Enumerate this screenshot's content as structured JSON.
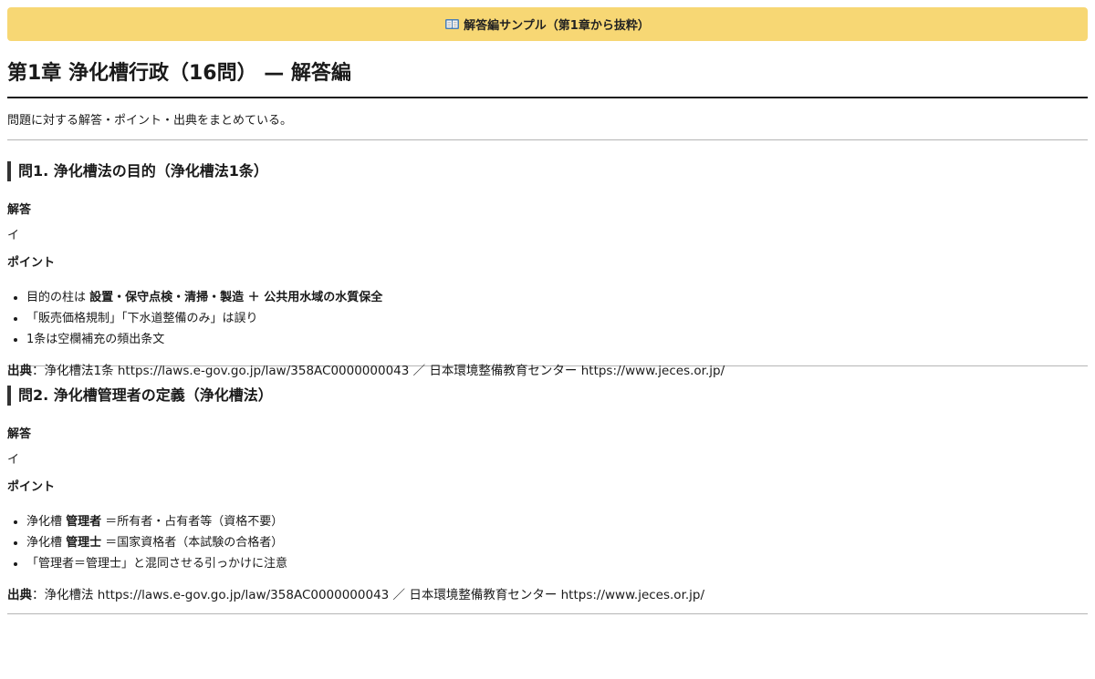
{
  "banner": {
    "icon": "book-icon",
    "text": "解答編サンプル（第1章から抜粋）"
  },
  "page_title": "第1章 浄化槽行政（16問） — 解答編",
  "intro": "問題に対する解答・ポイント・出典をまとめている。",
  "questions": [
    {
      "title": "問1. 浄化槽法の目的（浄化槽法1条）",
      "answer_label": "解答",
      "answer": "イ",
      "points_label": "ポイント",
      "points": [
        {
          "pre": "目的の柱は ",
          "bold": "設置・保守点検・清掃・製造 ＋ 公共用水域の水質保全",
          "post": ""
        },
        {
          "pre": "「販売価格規制」「下水道整備のみ」は誤り",
          "bold": "",
          "post": ""
        },
        {
          "pre": "1条は空欄補充の頻出条文",
          "bold": "",
          "post": ""
        }
      ],
      "source_label": "出典",
      "source_text": "：浄化槽法1条 https://laws.e-gov.go.jp/law/358AC0000000043 ／ 日本環境整備教育センター https://www.jeces.or.jp/"
    },
    {
      "title": "問2. 浄化槽管理者の定義（浄化槽法）",
      "answer_label": "解答",
      "answer": "イ",
      "points_label": "ポイント",
      "points": [
        {
          "pre": "浄化槽 ",
          "bold": "管理者",
          "post": " ＝所有者・占有者等（資格不要）"
        },
        {
          "pre": "浄化槽 ",
          "bold": "管理士",
          "post": " ＝国家資格者（本試験の合格者）"
        },
        {
          "pre": "「管理者＝管理士」と混同させる引っかけに注意",
          "bold": "",
          "post": ""
        }
      ],
      "source_label": "出典",
      "source_text": "：浄化槽法 https://laws.e-gov.go.jp/law/358AC0000000043 ／ 日本環境整備教育センター https://www.jeces.or.jp/"
    }
  ]
}
